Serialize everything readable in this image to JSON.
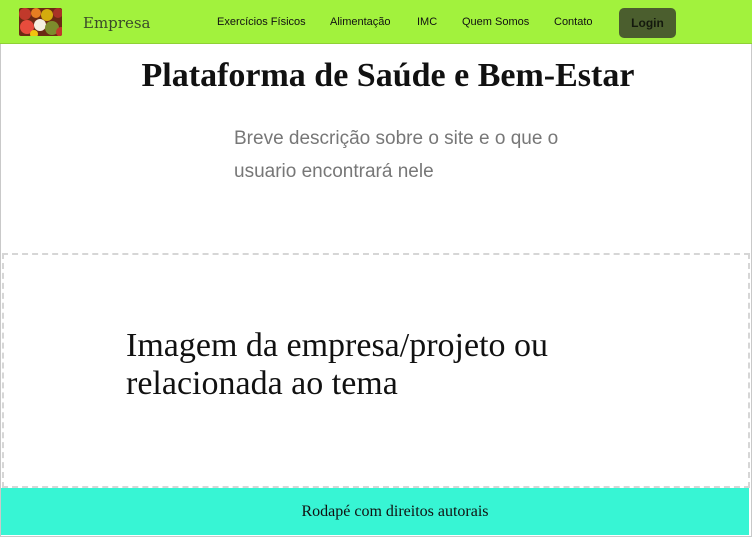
{
  "navbar": {
    "brand": "Empresa",
    "links": [
      "Exercícios Físicos",
      "Alimentação",
      "IMC",
      "Quem Somos",
      "Contato"
    ],
    "login_label": "Login"
  },
  "hero": {
    "title": "Plataforma de Saúde e Bem-Estar",
    "description": "Breve descrição sobre o site e o que o usuario encontrará nele"
  },
  "image_placeholder": {
    "text": "Imagem da empresa/projeto ou relacionada ao tema"
  },
  "footer": {
    "text": "Rodapé com direitos autorais"
  }
}
